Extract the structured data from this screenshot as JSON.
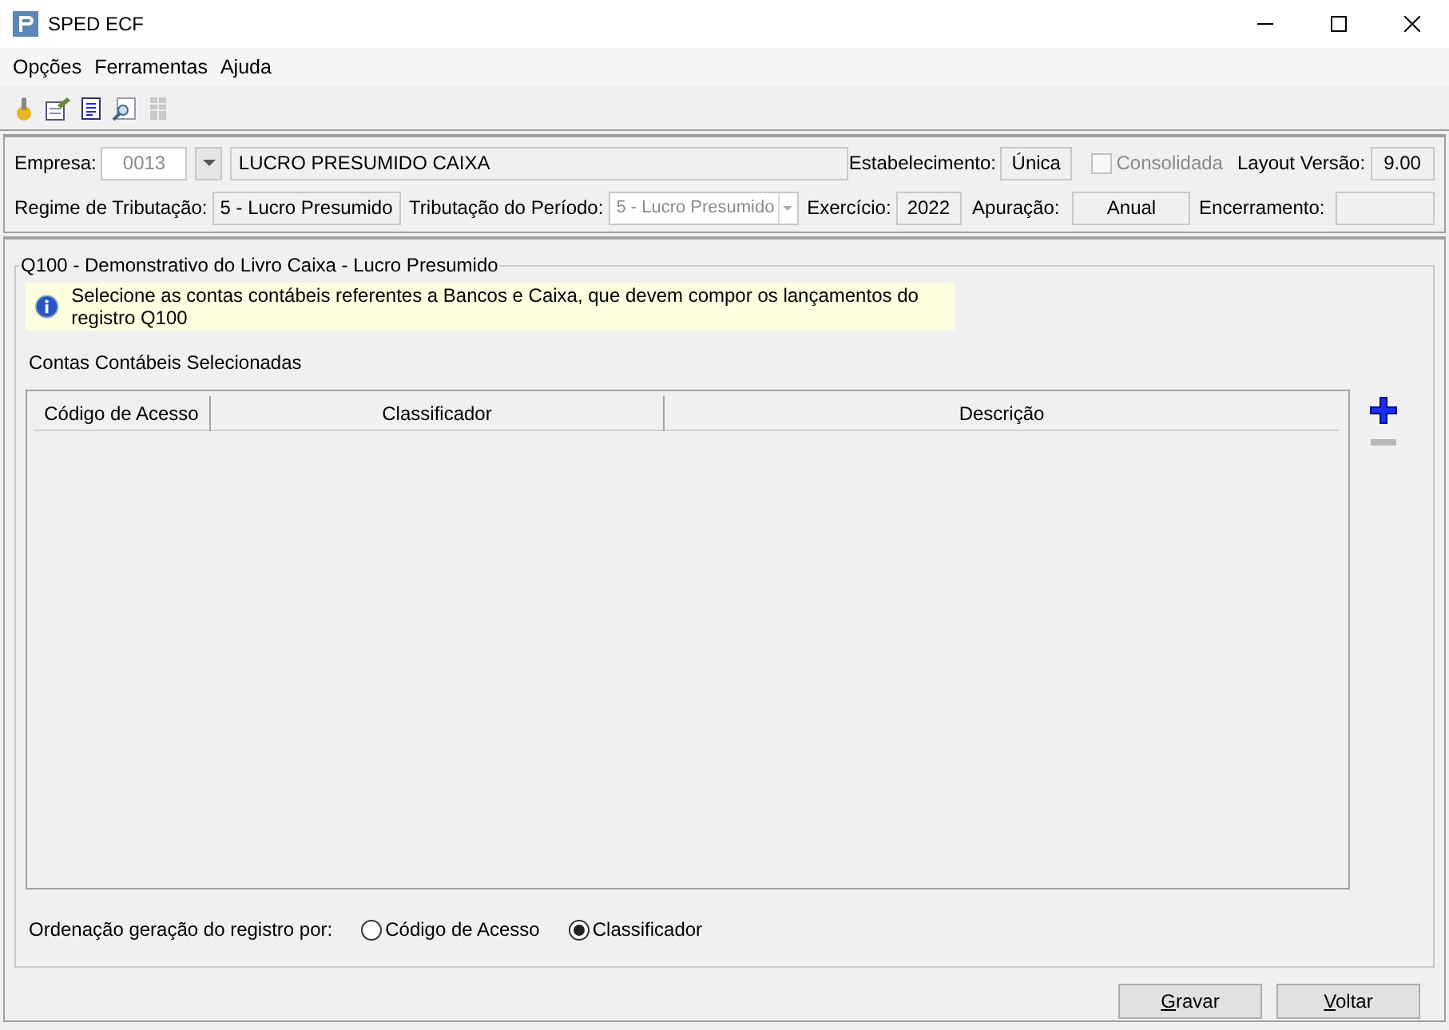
{
  "window": {
    "title": "SPED ECF"
  },
  "menu": [
    "Opções",
    "Ferramentas",
    "Ajuda"
  ],
  "header": {
    "empresa": {
      "label": "Empresa:",
      "code": "0013",
      "name": "LUCRO PRESUMIDO CAIXA"
    },
    "estabelecimento": {
      "label": "Estabelecimento:",
      "value": "Única"
    },
    "consolidada": {
      "label": "Consolidada",
      "checked": false,
      "disabled": true
    },
    "layout": {
      "label": "Layout Versão:",
      "value": "9.00"
    },
    "regime": {
      "label": "Regime de Tributação:",
      "value": "5 - Lucro Presumido"
    },
    "tributacao_periodo": {
      "label": "Tributação do Período:",
      "value": "5 - Lucro Presumido",
      "disabled": true
    },
    "exercicio": {
      "label": "Exercício:",
      "value": "2022"
    },
    "apuracao": {
      "label": "Apuração:",
      "value": "Anual"
    },
    "encerramento": {
      "label": "Encerramento:"
    }
  },
  "group": {
    "title": "Q100 - Demonstrativo do Livro Caixa - Lucro Presumido",
    "info": "Selecione as contas contábeis referentes a Bancos e Caixa, que devem compor os lançamentos do registro Q100",
    "list_label": "Contas Contábeis Selecionadas",
    "table": {
      "columns": [
        "Código de Acesso",
        "Classificador",
        "Descrição"
      ]
    },
    "remove_enabled": false,
    "ordering": {
      "label": "Ordenação geração do registro por:",
      "options": [
        {
          "label": "Código de Acesso",
          "selected": false
        },
        {
          "label": "Classificador",
          "selected": true
        }
      ]
    }
  },
  "buttons": [
    "Gravar",
    "Voltar"
  ]
}
